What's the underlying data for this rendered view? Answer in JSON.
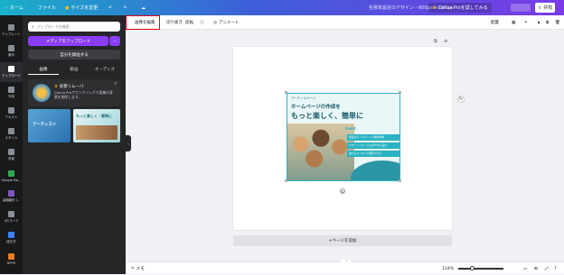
{
  "topbar": {
    "home": "ホーム",
    "file": "ファイル",
    "resize": "サイズを変更",
    "doc_title": "名称未設定のデザイン - 600px × 600px",
    "try_pro": "Canva Proを試してみる",
    "share": "共有"
  },
  "rail": {
    "items": [
      {
        "label": "テンプレート",
        "icon": "template-icon"
      },
      {
        "label": "素材",
        "icon": "elements-icon"
      },
      {
        "label": "アップロード",
        "icon": "upload-icon"
      },
      {
        "label": "写真",
        "icon": "photo-icon"
      },
      {
        "label": "テキスト",
        "icon": "text-icon"
      },
      {
        "label": "スタイル",
        "icon": "style-icon"
      },
      {
        "label": "背景",
        "icon": "background-icon"
      },
      {
        "label": "Google Ma…",
        "icon": "maps-icon"
      },
      {
        "label": "協働翻訳 (…",
        "icon": "translate-icon"
      },
      {
        "label": "QRコード",
        "icon": "qrcode-icon"
      },
      {
        "label": "描文字",
        "icon": "handwriting-icon"
      },
      {
        "label": "BPPR",
        "icon": "app-icon"
      }
    ]
  },
  "panel": {
    "search_placeholder": "アップロードの検索",
    "upload_button": "メディアをアップロード",
    "record_button": "自分を録画する",
    "tabs": [
      "画像",
      "動画",
      "オーディオ"
    ],
    "promo_title": "背景リムーバ",
    "promo_text": "Canva Proでワンクリックで画像の背景を削除します。",
    "thumb_text": "アーティスト",
    "thumb2_text": "もっと楽しく・簡単に"
  },
  "toolbar": {
    "edit_image": "画像を編集",
    "crop": "切り抜き",
    "flip": "反転",
    "animate": "アニメート",
    "position": "配置"
  },
  "design": {
    "brand": "アーティスページ",
    "headline1": "ホームページの作成を",
    "headline2": "もっと楽しく、簡単に",
    "point_label": "Point",
    "points": [
      "豊富なテンプレートで簡単作成",
      "スマートフォンでも見やすい設計",
      "誰でもカンタンに更新できる"
    ]
  },
  "canvas": {
    "add_page": "+ページを追加"
  },
  "bottombar": {
    "notes": "メモ",
    "zoom": "124%"
  },
  "colors": {
    "accent": "#8b3dff",
    "teal": "#2ab3c2",
    "highlight": "#e60012"
  }
}
